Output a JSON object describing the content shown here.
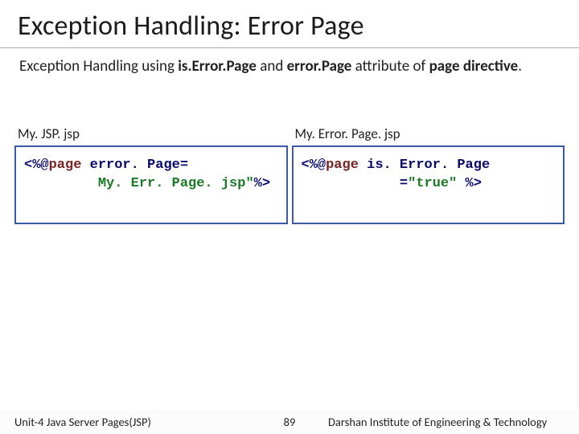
{
  "title": "Exception Handling: Error Page",
  "subtitle_parts": {
    "p1": "Exception Handling using ",
    "b1": "is.Error.Page",
    "p2": " and ",
    "b2": "error.Page",
    "p3": " attribute of ",
    "b3": "page directive",
    "p4": "."
  },
  "left": {
    "filename": "My. JSP. jsp",
    "code": {
      "seg1": "<%@",
      "seg2": "page",
      "seg3": " error. Page=",
      "seg4": "\n         My. Err. Page. jsp\"",
      "seg5": "%>"
    }
  },
  "right": {
    "filename": "My. Error. Page. jsp",
    "code": {
      "seg1": "<%@",
      "seg2": "page",
      "seg3": " is. Error. Page",
      "seg4": "\n            =",
      "seg5": "\"true\"",
      "seg6": " %>"
    }
  },
  "footer": {
    "left": "Unit-4 Java Server Pages(JSP)",
    "page": "89",
    "right": "Darshan Institute of Engineering & Technology"
  }
}
